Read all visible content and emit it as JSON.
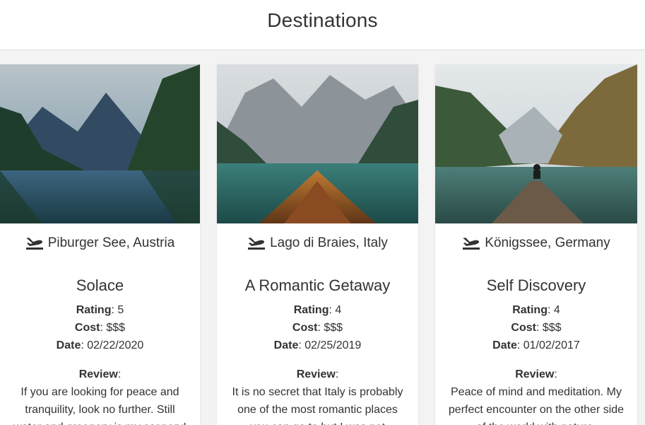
{
  "header": {
    "title": "Destinations"
  },
  "cards": [
    {
      "location": "Piburger See, Austria",
      "title": "Solace",
      "rating_label": "Rating",
      "rating": ": 5",
      "cost_label": "Cost",
      "cost": ": $$$",
      "date_label": "Date",
      "date": ": 02/22/2020",
      "review_label": "Review",
      "review_colon": ":",
      "review": "If you are looking for peace and tranquility, look no further. Still water and greenery is my scenery!"
    },
    {
      "location": "Lago di Braies, Italy",
      "title": "A Romantic Getaway",
      "rating_label": "Rating",
      "rating": ": 4",
      "cost_label": "Cost",
      "cost": ": $$$",
      "date_label": "Date",
      "date": ": 02/25/2019",
      "review_label": "Review",
      "review_colon": ":",
      "review": "It is no secret that Italy is probably one of the most romantic places you can go to but I was not"
    },
    {
      "location": "Königssee, Germany",
      "title": "Self Discovery",
      "rating_label": "Rating",
      "rating": ": 4",
      "cost_label": "Cost",
      "cost": ": $$$",
      "date_label": "Date",
      "date": ": 01/02/2017",
      "review_label": "Review",
      "review_colon": ":",
      "review": "Peace of mind and meditation. My perfect encounter on the other side of the world with nature."
    }
  ],
  "icons": {
    "location_icon": "plane-landing-icon"
  },
  "colors": {
    "text": "#333333",
    "background": "#f3f3f3",
    "card": "#ffffff"
  }
}
